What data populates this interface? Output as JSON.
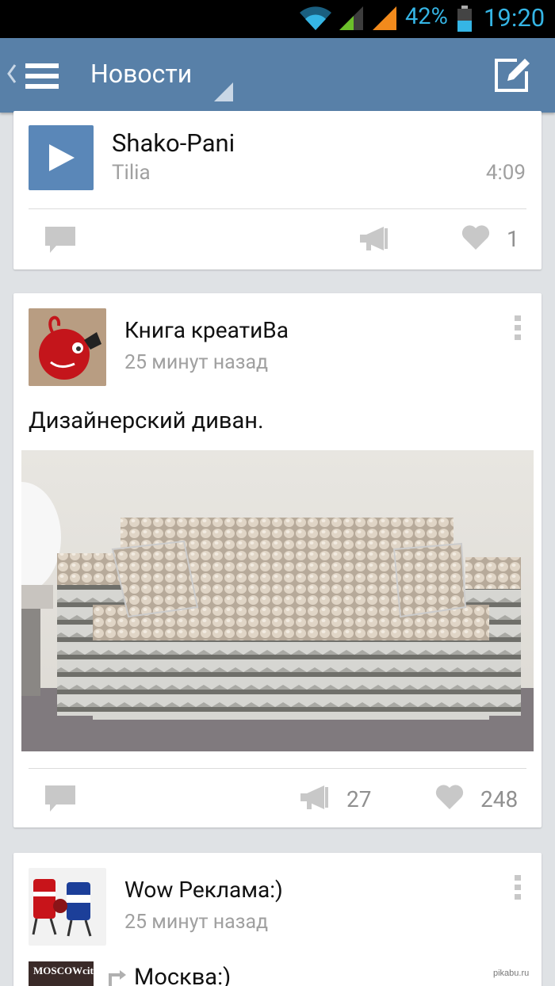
{
  "status_bar": {
    "battery_percent": "42%",
    "time": "19:20"
  },
  "action_bar": {
    "title": "Новости"
  },
  "audio_post": {
    "title": "Shako-Pani",
    "artist": "Tilia",
    "duration": "4:09",
    "likes": "1"
  },
  "post1": {
    "author": "Книга креатиВа",
    "time": "25 минут назад",
    "text": "Дизайнерский диван.",
    "reposts": "27",
    "likes": "248"
  },
  "post2": {
    "author": "Wow Реклама:)",
    "time": "25 минут назад",
    "repost_thumb_text": "MOSCOWcity",
    "repost_title": "Москва:)"
  },
  "watermark": "pikabu.ru",
  "colors": {
    "accent": "#5880a8",
    "status": "#35b5e5",
    "icon_gray": "#c8c8c8"
  }
}
